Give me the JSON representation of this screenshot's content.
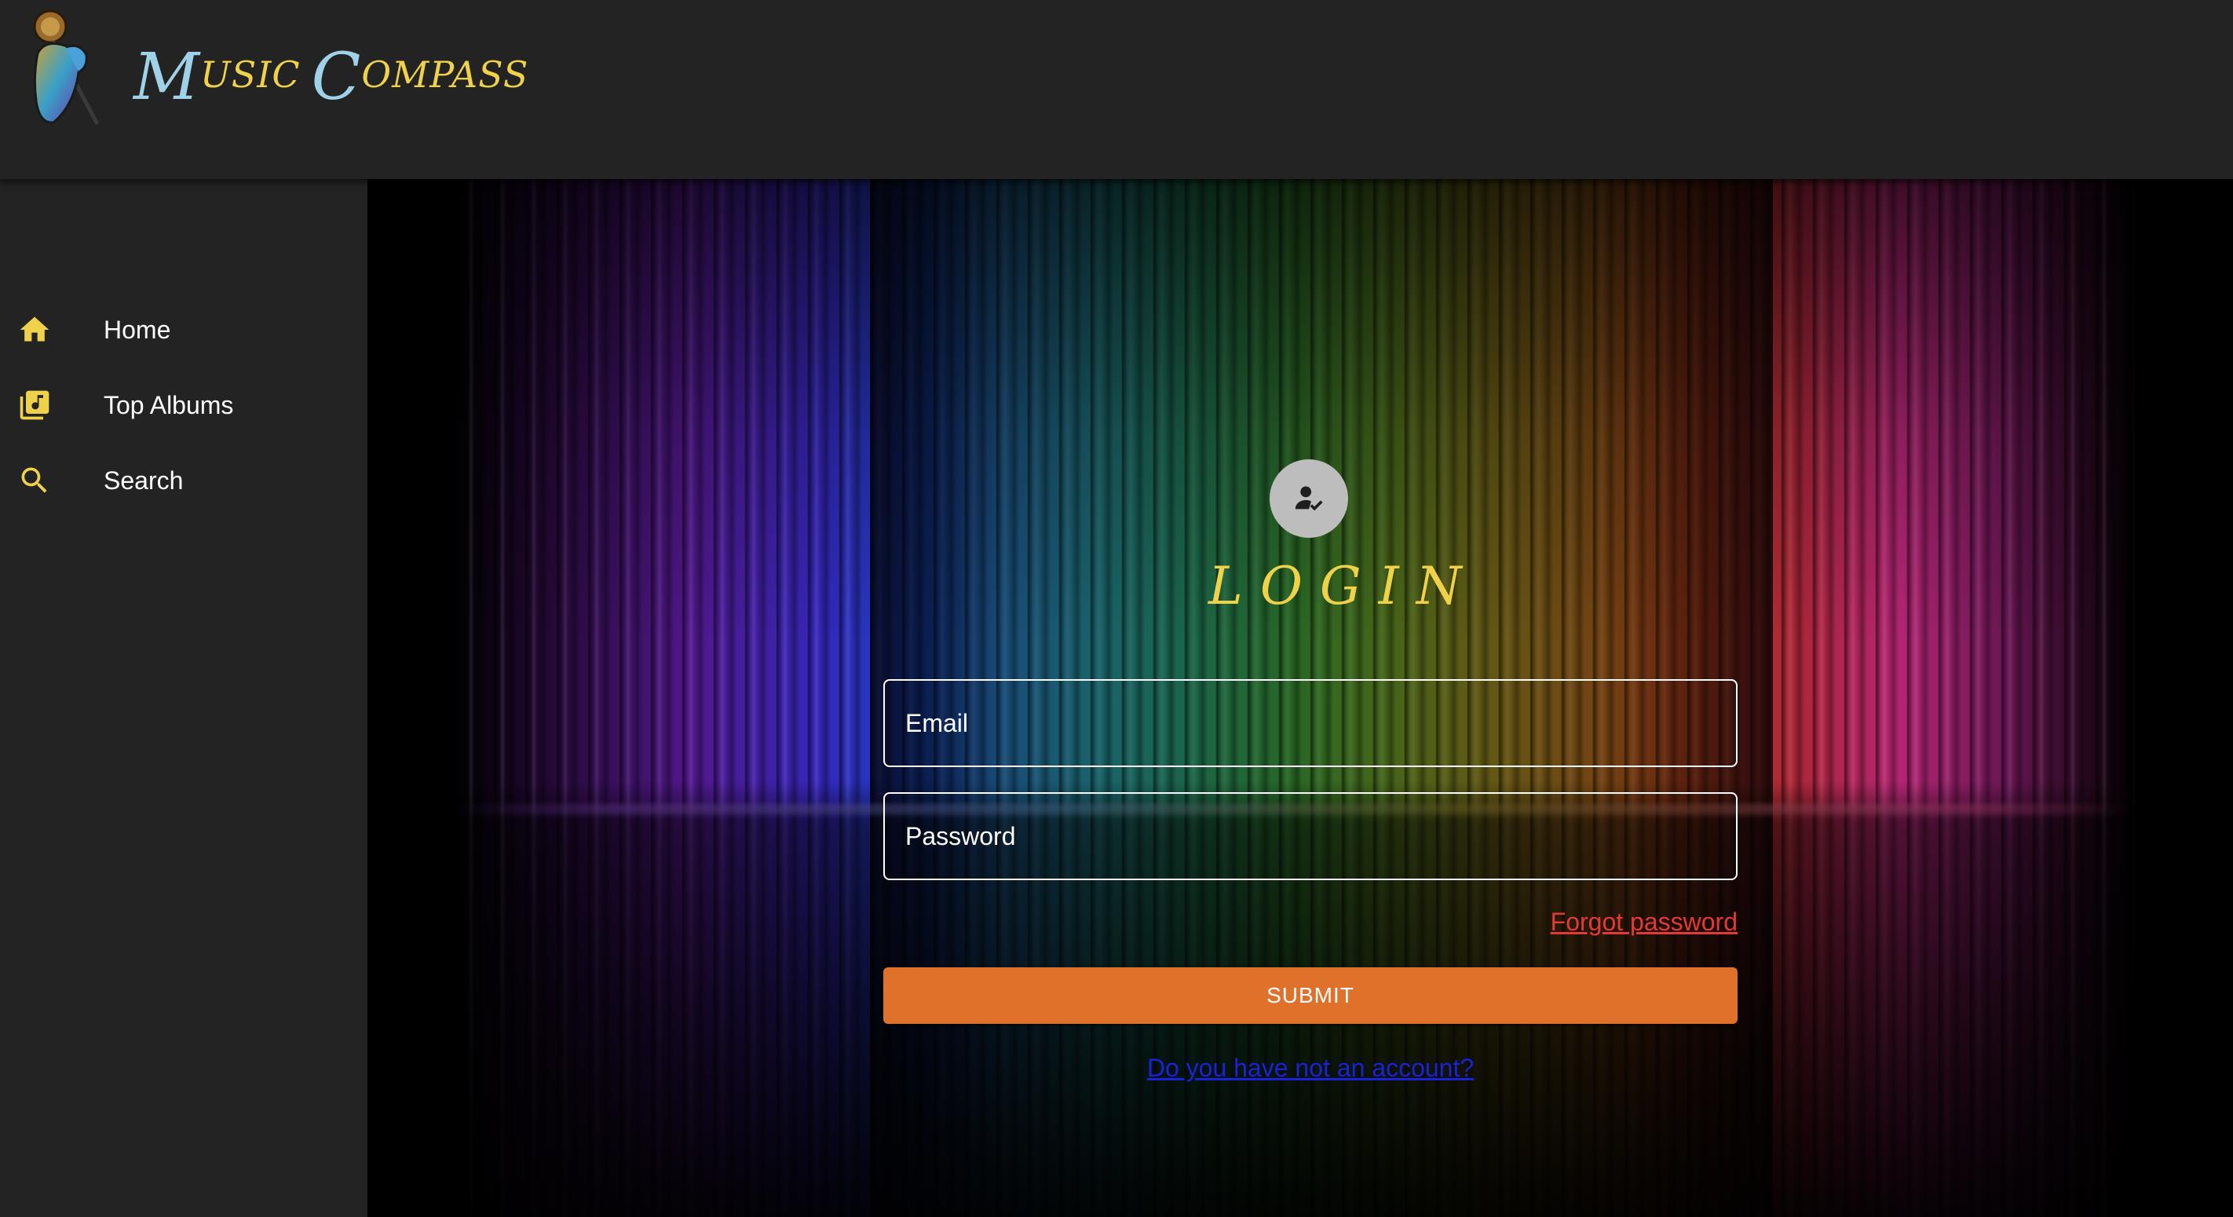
{
  "header": {
    "logo_icon": "microphone-hand-logo",
    "brand_first_big": "M",
    "brand_first_rest": "USIC",
    "brand_second_big": "C",
    "brand_second_rest": "OMPASS",
    "brand_colors": {
      "big": "#9fd2e8",
      "small": "#f0d24a"
    }
  },
  "sidebar": {
    "items": [
      {
        "label": "Home",
        "icon": "home-icon"
      },
      {
        "label": "Top Albums",
        "icon": "album-library-icon"
      },
      {
        "label": "Search",
        "icon": "search-icon"
      }
    ],
    "icon_color": "#f0d24a"
  },
  "login": {
    "avatar_icon": "user-check-icon",
    "title": "LOGIN",
    "email": {
      "placeholder": "Email",
      "value": ""
    },
    "password": {
      "placeholder": "Password",
      "value": ""
    },
    "forgot_label": "Forgot password",
    "submit_label": "SUBMIT",
    "signup_label": "Do you have not an account?"
  },
  "colors": {
    "accent": "#e0712b",
    "title": "#f0d24a",
    "link_forgot": "#e53935",
    "link_signup": "#1a22d8",
    "panel": "#232323"
  }
}
